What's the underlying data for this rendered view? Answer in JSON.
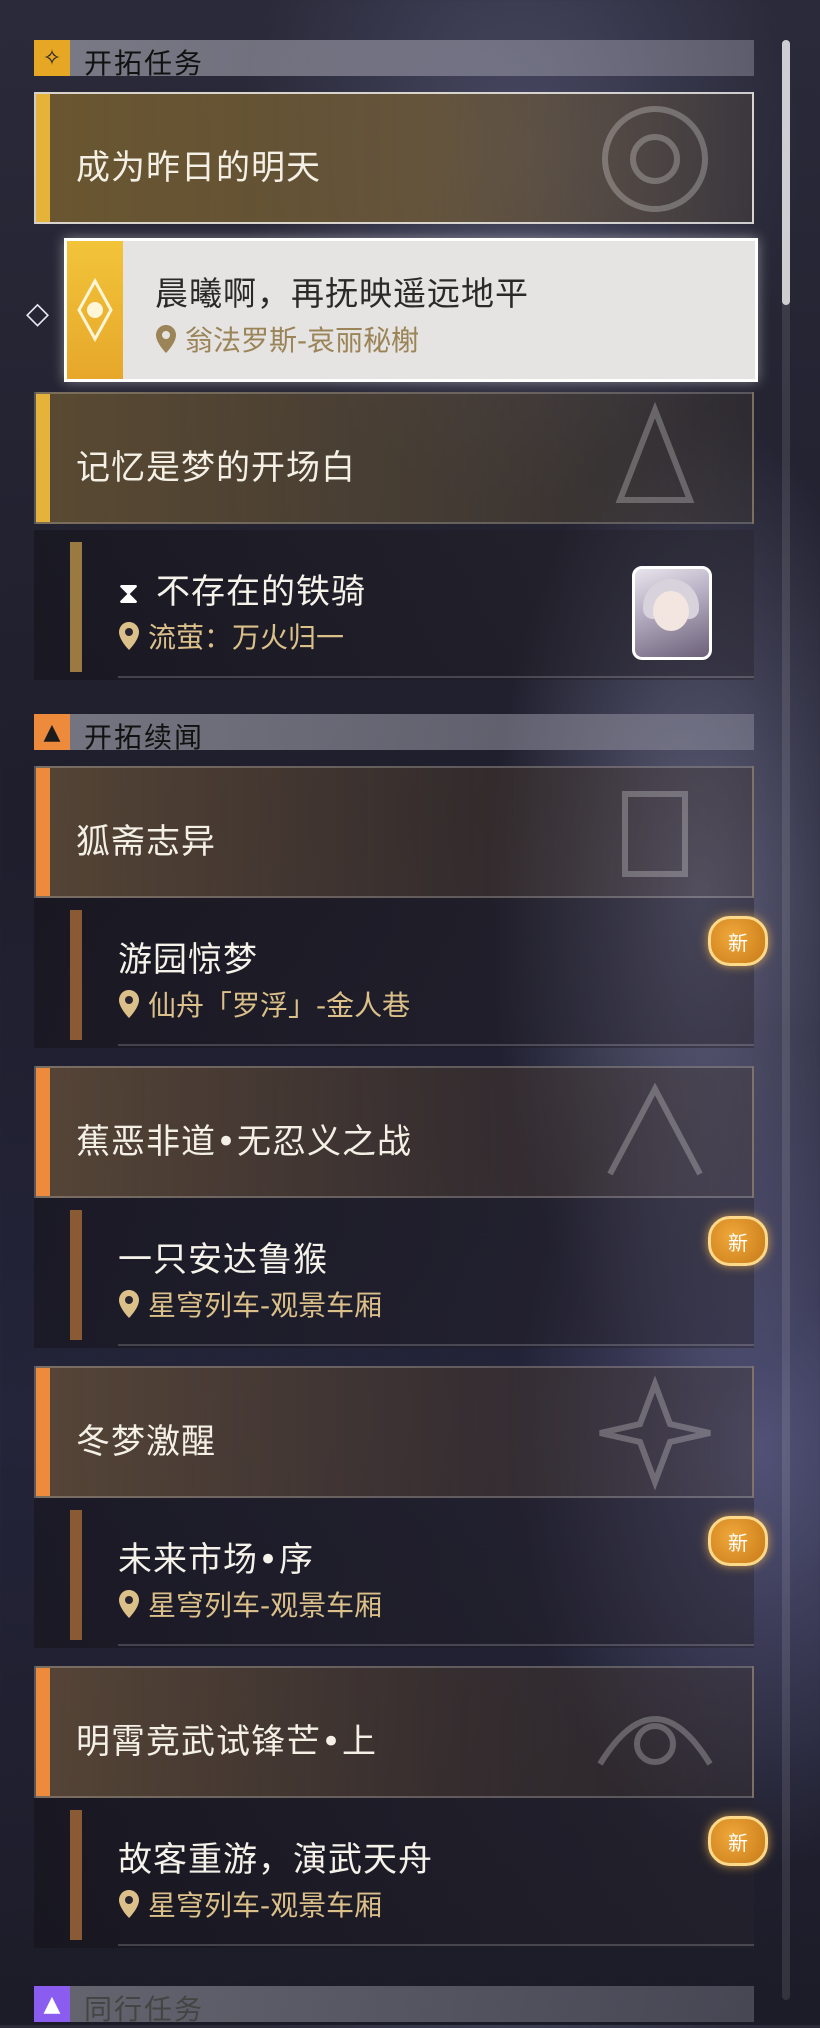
{
  "sections": [
    {
      "title": "开拓任务",
      "icon": "trailblaze-mission-icon"
    },
    {
      "title": "开拓续闻",
      "icon": "trailblaze-continuance-icon"
    },
    {
      "title": "同行任务",
      "icon": "companion-mission-icon"
    }
  ],
  "chapters": [
    {
      "title": "成为昨日的明天"
    },
    {
      "title": "记忆是梦的开场白"
    },
    {
      "title": "狐斋志异"
    },
    {
      "title": "蕉恶非道•无忍义之战"
    },
    {
      "title": "冬梦激醒"
    },
    {
      "title": "明霄竞武试锋芒•上"
    }
  ],
  "active_quest": {
    "title": "晨曦啊，再抚映遥远地平",
    "location": "翁法罗斯-哀丽秘榭"
  },
  "quests": [
    {
      "title": "不存在的铁骑",
      "location": "流萤：万火归一"
    },
    {
      "title": "游园惊梦",
      "location": "仙舟「罗浮」-金人巷",
      "badge": "新"
    },
    {
      "title": "一只安达鲁猴",
      "location": "星穹列车-观景车厢",
      "badge": "新"
    },
    {
      "title": "未来市场•序",
      "location": "星穹列车-观景车厢",
      "badge": "新"
    },
    {
      "title": "故客重游，演武天舟",
      "location": "星穹列车-观景车厢",
      "badge": "新"
    }
  ],
  "colors": {
    "gold_accent": "#e6b33a",
    "orange_accent": "#ee8a3c",
    "location_text": "#dcc08a",
    "new_badge": "#e89a2a"
  }
}
